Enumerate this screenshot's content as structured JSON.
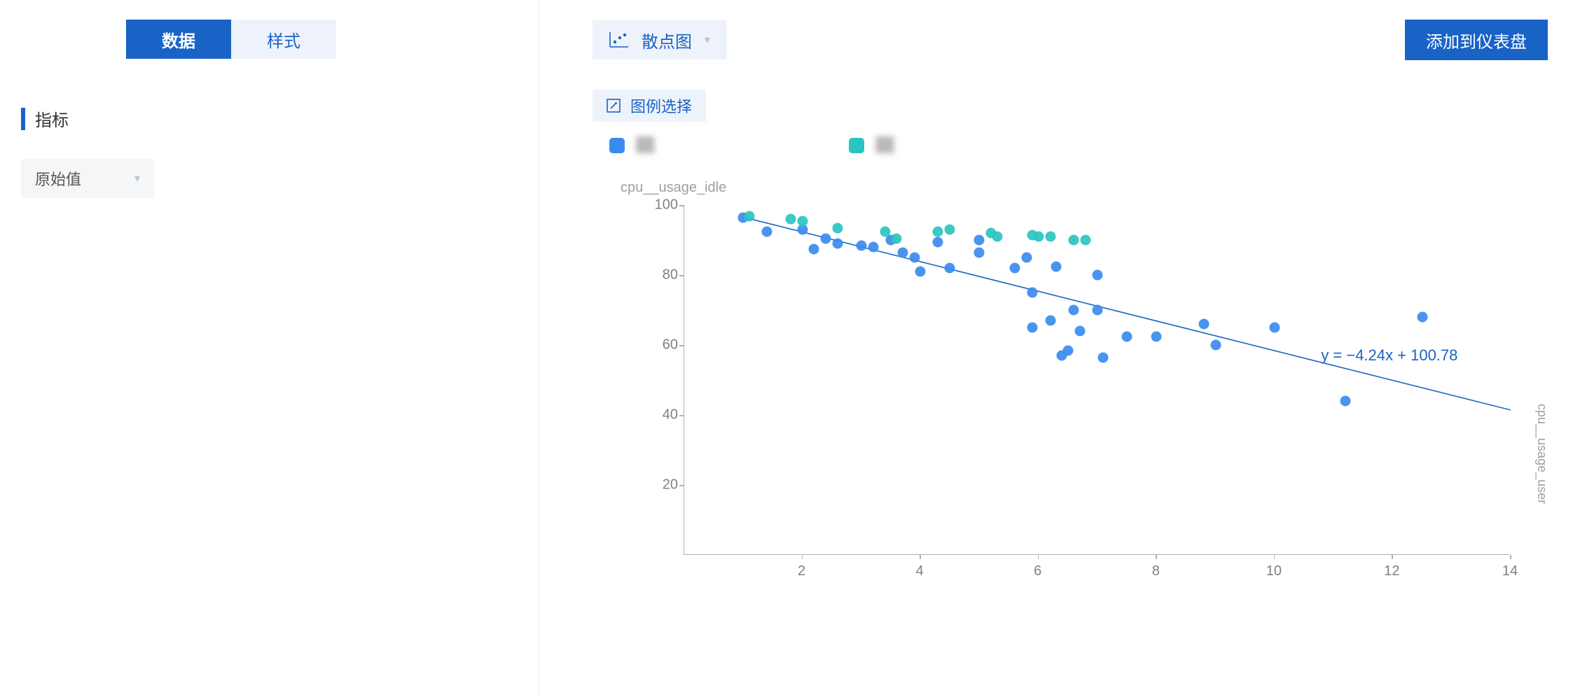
{
  "left": {
    "tabs": {
      "data": "数据",
      "style": "样式"
    },
    "section_title": "指标",
    "value_mode": "原始值"
  },
  "right": {
    "chart_type": "散点图",
    "add_button": "添加到仪表盘",
    "legend_select": "图例选择",
    "legend": [
      {
        "color": "#3b8bef",
        "label": "██"
      },
      {
        "color": "#2bc4c0",
        "label": "██"
      }
    ]
  },
  "chart_data": {
    "type": "scatter",
    "title": "",
    "xlabel": "cpu__usage_user",
    "ylabel": "cpu__usage_idle",
    "xlim": [
      0,
      14
    ],
    "ylim": [
      0,
      100
    ],
    "x_ticks": [
      2,
      4,
      6,
      8,
      10,
      12,
      14
    ],
    "y_ticks": [
      20,
      40,
      60,
      80,
      100
    ],
    "trendline": {
      "slope": -4.24,
      "intercept": 100.78,
      "equation": "y = −4.24x + 100.78",
      "x_range": [
        1.0,
        14.0
      ]
    },
    "series": [
      {
        "name": "series-1",
        "color": "#3b8bef",
        "points": [
          [
            1.0,
            96.5
          ],
          [
            1.4,
            92.5
          ],
          [
            2.0,
            93.0
          ],
          [
            2.2,
            87.5
          ],
          [
            2.4,
            90.5
          ],
          [
            2.6,
            89.0
          ],
          [
            3.0,
            88.5
          ],
          [
            3.2,
            88.0
          ],
          [
            3.5,
            90.0
          ],
          [
            3.7,
            86.5
          ],
          [
            3.9,
            85.0
          ],
          [
            4.0,
            81.0
          ],
          [
            4.3,
            89.5
          ],
          [
            4.5,
            82.0
          ],
          [
            5.0,
            90.0
          ],
          [
            5.0,
            86.5
          ],
          [
            5.6,
            82.0
          ],
          [
            5.8,
            85.0
          ],
          [
            5.9,
            75.0
          ],
          [
            5.9,
            65.0
          ],
          [
            6.2,
            67.0
          ],
          [
            6.3,
            82.5
          ],
          [
            6.4,
            57.0
          ],
          [
            6.5,
            58.5
          ],
          [
            6.6,
            70.0
          ],
          [
            6.7,
            64.0
          ],
          [
            7.0,
            80.0
          ],
          [
            7.0,
            70.0
          ],
          [
            7.1,
            56.5
          ],
          [
            7.5,
            62.5
          ],
          [
            8.0,
            62.5
          ],
          [
            8.8,
            66.0
          ],
          [
            9.0,
            60.0
          ],
          [
            10.0,
            65.0
          ],
          [
            11.2,
            44.0
          ],
          [
            12.5,
            68.0
          ]
        ]
      },
      {
        "name": "series-2",
        "color": "#2bc4c0",
        "points": [
          [
            1.1,
            96.8
          ],
          [
            1.8,
            96.0
          ],
          [
            2.0,
            95.5
          ],
          [
            2.6,
            93.5
          ],
          [
            3.4,
            92.5
          ],
          [
            3.6,
            90.5
          ],
          [
            4.3,
            92.5
          ],
          [
            4.5,
            93.0
          ],
          [
            5.2,
            92.0
          ],
          [
            5.3,
            91.0
          ],
          [
            5.9,
            91.5
          ],
          [
            6.0,
            91.0
          ],
          [
            6.2,
            91.0
          ],
          [
            6.6,
            90.0
          ],
          [
            6.8,
            90.0
          ]
        ]
      }
    ]
  }
}
